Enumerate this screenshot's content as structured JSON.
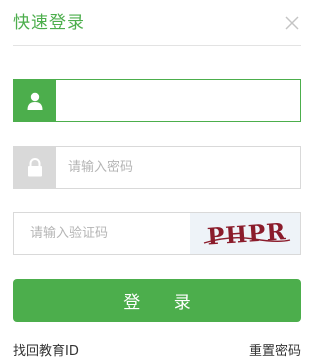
{
  "header": {
    "title": "快速登录",
    "close_icon": "close-icon"
  },
  "form": {
    "username": {
      "value": "",
      "placeholder": "",
      "icon": "user-icon"
    },
    "password": {
      "value": "",
      "placeholder": "请输入密码",
      "icon": "lock-icon"
    },
    "captcha": {
      "value": "",
      "placeholder": "请输入验证码",
      "image_text": "PHPR"
    }
  },
  "actions": {
    "login_label": "登 录"
  },
  "links": {
    "recover_id": "找回教育ID",
    "reset_password": "重置密码"
  },
  "colors": {
    "accent": "#4cae4c",
    "inactive_icon_bg": "#d9d9d9",
    "captcha_text": "#8b1c2b"
  }
}
